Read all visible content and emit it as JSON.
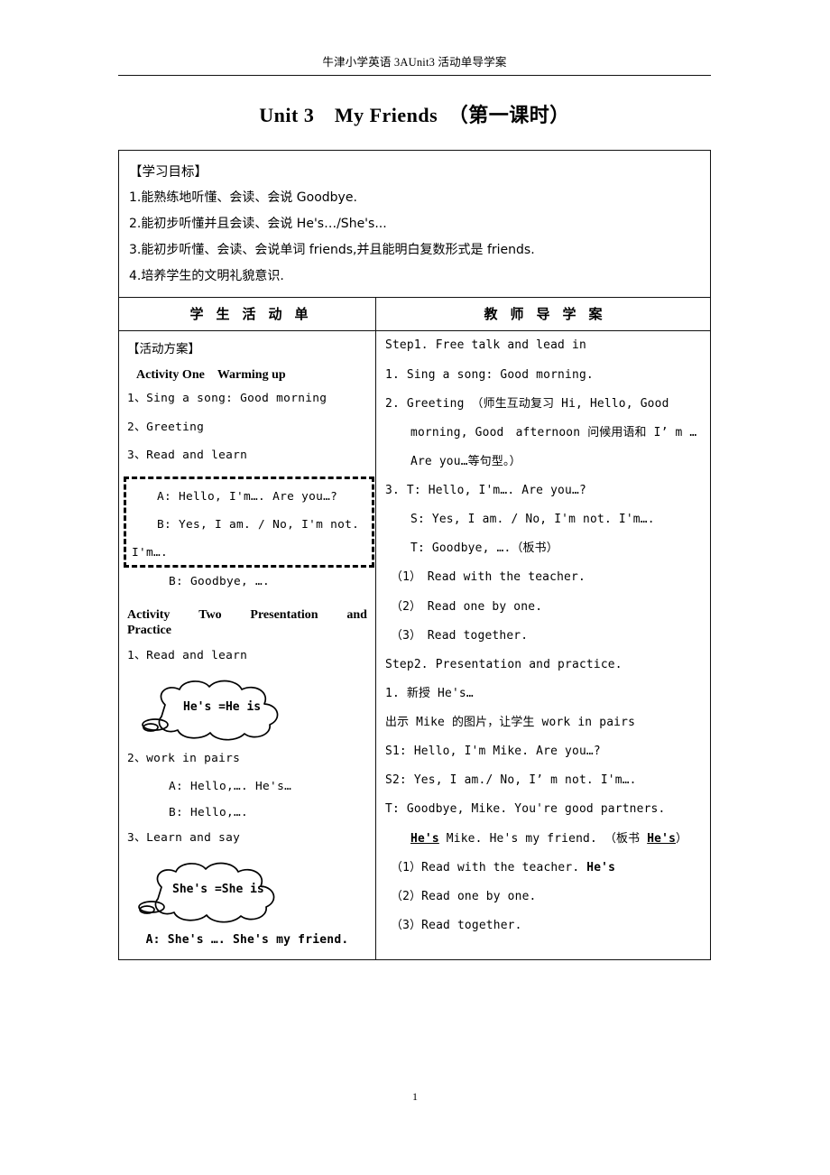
{
  "header": {
    "running_head": "牛津小学英语 3AUnit3 活动单导学案",
    "title": "Unit 3　My Friends　（第一课时）",
    "page_number": "1"
  },
  "objectives": {
    "heading": "【学习目标】",
    "items": [
      "1.能熟练地听懂、会读、会说 Goodbye.",
      "2.能初步听懂并且会读、会说 He's…/She's...",
      "3.能初步听懂、会读、会说单词 friends,并且能明白复数形式是 friends.",
      "4.培养学生的文明礼貌意识."
    ]
  },
  "columns": {
    "left_header": "学生活动单",
    "right_header": "教师导学案"
  },
  "student_column": {
    "section_heading": "【活动方案】",
    "activity_one": {
      "title": "Activity One　Warming up",
      "items": [
        "1、Sing a song: Good morning",
        "2、Greeting",
        "3、Read and learn"
      ],
      "dialogue_box": {
        "line_a": "A: Hello, I'm…. Are you…?",
        "line_b": "B: Yes, I am. / No, I'm not.",
        "line_c": "I'm…."
      },
      "after_box_line": "B: Goodbye, …."
    },
    "activity_two": {
      "title_part1": "Activity",
      "title_part2": "Two",
      "title_part3": "Presentation",
      "title_part4": "and",
      "title_part5": "Practice",
      "item1": "1、Read and learn",
      "cloud1": "He's =He is",
      "item2": "2、work in pairs",
      "pair_a": "A: Hello,…. He's…",
      "pair_b": "B: Hello,….",
      "item3": "3、Learn and say",
      "cloud2": "She's =She is",
      "final_line": "A: She's ….  She's my friend."
    }
  },
  "teacher_column": {
    "step1": {
      "heading": "Step1. Free talk and lead in",
      "item1": "1.  Sing a song: Good morning.",
      "item2_line1": "2.  Greeting （师生互动复习 Hi, Hello, Good",
      "item2_line2": "morning, Good　afternoon 问候用语和 I’ m …",
      "item2_line3": "Are you…等句型。）",
      "item3_t": "3.  T: Hello, I'm…. Are you…?",
      "item3_s": "S: Yes, I am. / No, I'm not. I'm….",
      "item3_t2": "T: Goodbye, ….（板书）",
      "sub1": "（1）　Read with the teacher.",
      "sub2": "（2）　Read one by one.",
      "sub3": "（3）　Read together."
    },
    "step2": {
      "heading": "Step2. Presentation and practice.",
      "item1": "1.  新授 He's…",
      "line_show": "出示 Mike 的图片，让学生 work in pairs",
      "s1": "S1: Hello, I'm Mike. Are you…?",
      "s2": "S2: Yes, I am./ No, I’ m not. I'm….",
      "t": "T:  Goodbye, Mike. You're good partners.",
      "t_cont_pre": "",
      "t_cont_hes": "He's",
      "t_cont_mid": " Mike. He's my friend. （板书 ",
      "t_cont_hes2": "He's",
      "t_cont_end": "）",
      "sub1_pre": "（1）Read with the teacher. ",
      "sub1_bold": "He's",
      "sub2": "（2）Read one by one.",
      "sub3": "（3）Read together."
    }
  },
  "style": {
    "ink": "#000000",
    "paper": "#ffffff"
  }
}
